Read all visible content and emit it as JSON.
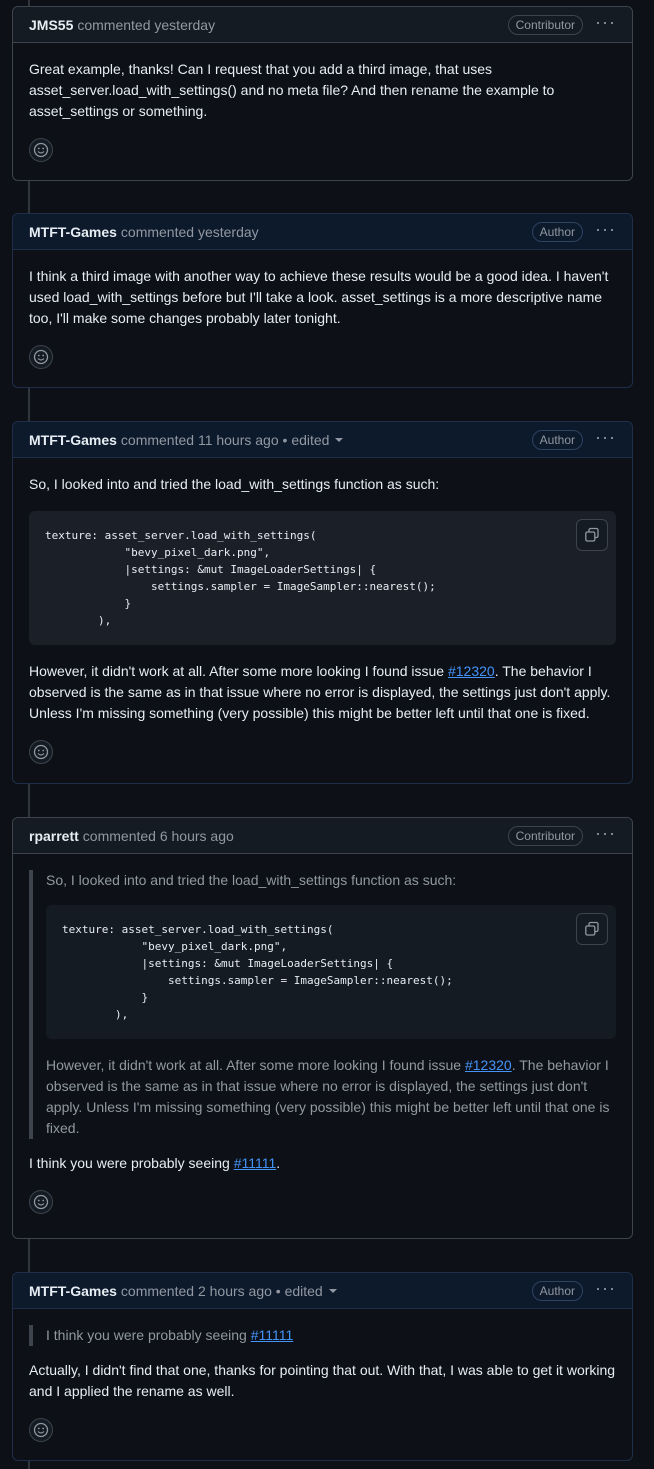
{
  "comments": [
    {
      "user": "JMS55",
      "meta": "commented yesterday",
      "badge": "Contributor",
      "body": "Great example, thanks! Can I request that you add a third image, that uses asset_server.load_with_settings() and no meta file? And then rename the example to asset_settings or something."
    },
    {
      "user": "MTFT-Games",
      "meta": "commented yesterday",
      "badge": "Author",
      "body": "I think a third image with another way to achieve these results would be a good idea. I haven't used load_with_settings before but I'll take a look. asset_settings is a more descriptive name too, I'll make some changes probably later tonight."
    },
    {
      "user": "MTFT-Games",
      "meta": "commented 11 hours ago • edited",
      "badge": "Author",
      "intro": "So, I looked into and tried the load_with_settings function as such:",
      "code": "texture: asset_server.load_with_settings(\n            \"bevy_pixel_dark.png\",\n            |settings: &mut ImageLoaderSettings| {\n                settings.sampler = ImageSampler::nearest();\n            }\n        ),",
      "after_pre": "However, it didn't work at all. After some more looking I found issue ",
      "after_link": "#12320",
      "after_post": ". The behavior I observed is the same as in that issue where no error is displayed, the settings just don't apply. Unless I'm missing something (very possible) this might be better left until that one is fixed."
    },
    {
      "user": "rparrett",
      "meta": "commented 6 hours ago",
      "badge": "Contributor",
      "quote_intro": "So, I looked into and tried the load_with_settings function as such:",
      "quote_code": "texture: asset_server.load_with_settings(\n            \"bevy_pixel_dark.png\",\n            |settings: &mut ImageLoaderSettings| {\n                settings.sampler = ImageSampler::nearest();\n            }\n        ),",
      "quote_after_pre": "However, it didn't work at all. After some more looking I found issue ",
      "quote_after_link": "#12320",
      "quote_after_post": ". The behavior I observed is the same as in that issue where no error is displayed, the settings just don't apply. Unless I'm missing something (very possible) this might be better left until that one is fixed.",
      "reply_pre": "I think you were probably seeing ",
      "reply_link": "#11111",
      "reply_post": "."
    },
    {
      "user": "MTFT-Games",
      "meta": "commented 2 hours ago • edited",
      "badge": "Author",
      "quote_pre": "I think you were probably seeing ",
      "quote_link": "#11111",
      "body": "Actually, I didn't find that one, thanks for pointing that out. With that, I was able to get it working and I applied the rename as well."
    }
  ],
  "icons": {
    "more": "kebab-horizontal-icon",
    "emoji": "smiley-icon",
    "copy": "copy-icon"
  }
}
